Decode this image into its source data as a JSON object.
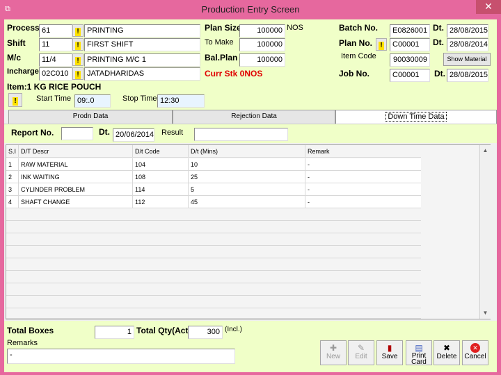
{
  "window": {
    "title": "Production Entry Screen",
    "close_glyph": "✕",
    "icon": "app-icon"
  },
  "header": {
    "process_label": "Process",
    "process_code": "61",
    "process_name": "PRINTING",
    "shift_label": "Shift",
    "shift_code": "11",
    "shift_name": "FIRST SHIFT",
    "mc_label": "M/c",
    "mc_code": "11/4",
    "mc_name": "PRINTING M/C 1",
    "incharge_label": "Incharge",
    "incharge_code": "02C010",
    "incharge_name": "JATADHARIDAS",
    "plan_size_label": "Plan Size",
    "plan_size_value": "100000",
    "plan_size_unit": "NOS",
    "to_make_label": "To Make",
    "to_make_value": "100000",
    "bal_plan_label": "Bal.Plan",
    "bal_plan_value": "100000",
    "curr_stk": "Curr Stk 0NOS",
    "batch_no_label": "Batch No.",
    "batch_no_value": "E0826001",
    "batch_dt_label": "Dt.",
    "batch_dt_value": "28/08/2015",
    "plan_no_label": "Plan No.",
    "plan_no_value": "C00001",
    "plan_dt_label": "Dt.",
    "plan_dt_value": "28/08/2014",
    "item_code_label": "Item Code",
    "item_code_value": "90030009",
    "show_material_label": "Show Material",
    "job_no_label": "Job No.",
    "job_no_value": "C00001",
    "job_dt_label": "Dt.",
    "job_dt_value": "28/08/2015",
    "item_text": "Item:1 KG RICE POUCH",
    "start_time_label": "Start Time",
    "start_time_value": "09:.0",
    "stop_time_label": "Stop Time",
    "stop_time_value": "12:30",
    "lookup_glyph": "!"
  },
  "tabs": [
    {
      "label": "Prodn Data"
    },
    {
      "label": "Rejection Data"
    },
    {
      "label": "Down Time Data"
    }
  ],
  "downtime_panel": {
    "report_no_label": "Report No.",
    "report_no_value": "",
    "dt_label": "Dt.",
    "dt_value": "20/06/2014",
    "result_label": "Result",
    "result_value": ""
  },
  "grid": {
    "columns": [
      "S.I",
      "D/T Descr",
      "D/t Code",
      "D/t (Mins)",
      "Remark"
    ],
    "rows": [
      [
        "1",
        "RAW MATERIAL",
        "104",
        "10",
        "-"
      ],
      [
        "2",
        "INK WAITING",
        "108",
        "25",
        "-"
      ],
      [
        "3",
        "CYLINDER PROBLEM",
        "114",
        "5",
        "-"
      ],
      [
        "4",
        "SHAFT CHANGE",
        "112",
        "45",
        "-"
      ]
    ]
  },
  "footer": {
    "total_boxes_label": "Total Boxes",
    "total_boxes_value": "1",
    "total_qty_label": "Total Qty(Act.)",
    "total_qty_value": "300",
    "total_qty_unit": "(Incl.)",
    "remarks_label": "Remarks",
    "remarks_value": "-"
  },
  "toolbar": {
    "new_label": "New",
    "edit_label": "Edit",
    "save_label": "Save",
    "print_card_label": "Print Card",
    "delete_label": "Delete",
    "cancel_label": "Cancel"
  },
  "colors": {
    "title_bar": "#e6689e",
    "panel": "#f0ffc8",
    "highlight_red": "#e00000"
  }
}
